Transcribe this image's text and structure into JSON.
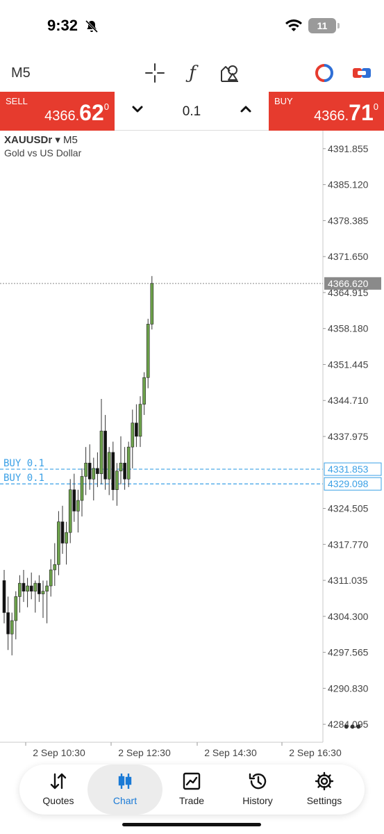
{
  "status_bar": {
    "time": "9:32",
    "battery": "11"
  },
  "toolbar": {
    "timeframe": "M5",
    "icons": [
      "crosshair-icon",
      "function-icon",
      "objects-icon",
      "one-click-trading-icon",
      "chart-toggle-icon"
    ],
    "func_glyph": "ƒ"
  },
  "trade": {
    "sell_label": "SELL",
    "sell_price_small": "4366.",
    "sell_price_big": "62",
    "sell_price_sup": "0",
    "buy_label": "BUY",
    "buy_price_small": "4366.",
    "buy_price_big": "71",
    "buy_price_sup": "0",
    "volume": "0.1"
  },
  "chart": {
    "symbol": "XAUUSDr",
    "timeframe_suffix": "▾ M5",
    "description": "Gold vs US Dollar",
    "more": "•••"
  },
  "chart_data": {
    "type": "candlestick",
    "symbol": "XAUUSDr",
    "timeframe": "M5",
    "ylim": [
      4280.73,
      4395.22
    ],
    "y_ticks": [
      "4391.855",
      "4385.120",
      "4378.385",
      "4371.650",
      "4364.915",
      "4358.180",
      "4351.445",
      "4344.710",
      "4337.975",
      "4324.505",
      "4317.770",
      "4311.035",
      "4304.300",
      "4297.565",
      "4290.830",
      "4284.095"
    ],
    "x_ticks": [
      "2 Sep 10:30",
      "2 Sep 12:30",
      "2 Sep 14:30",
      "2 Sep 16:30"
    ],
    "current_price": {
      "value": 4366.62,
      "label": "4366.620"
    },
    "orders": [
      {
        "label": "BUY 0.1",
        "price": 4331.853,
        "price_label": "4331.853"
      },
      {
        "label": "BUY 0.1",
        "price": 4329.098,
        "price_label": "4329.098"
      }
    ],
    "candles": [
      {
        "o": 4311.0,
        "h": 4313.0,
        "l": 4303.0,
        "c": 4305.0
      },
      {
        "o": 4305.0,
        "h": 4308.0,
        "l": 4298.0,
        "c": 4301.0
      },
      {
        "o": 4301.0,
        "h": 4305.0,
        "l": 4297.0,
        "c": 4303.5
      },
      {
        "o": 4303.5,
        "h": 4309.0,
        "l": 4300.0,
        "c": 4308.0
      },
      {
        "o": 4308.0,
        "h": 4312.0,
        "l": 4305.0,
        "c": 4310.5
      },
      {
        "o": 4310.5,
        "h": 4313.0,
        "l": 4307.0,
        "c": 4309.0
      },
      {
        "o": 4309.0,
        "h": 4311.5,
        "l": 4306.0,
        "c": 4310.0
      },
      {
        "o": 4310.0,
        "h": 4312.5,
        "l": 4307.5,
        "c": 4309.0
      },
      {
        "o": 4309.0,
        "h": 4311.0,
        "l": 4305.0,
        "c": 4310.5
      },
      {
        "o": 4310.5,
        "h": 4312.0,
        "l": 4307.0,
        "c": 4308.5
      },
      {
        "o": 4308.5,
        "h": 4311.0,
        "l": 4304.0,
        "c": 4309.0
      },
      {
        "o": 4309.0,
        "h": 4311.0,
        "l": 4303.0,
        "c": 4310.0
      },
      {
        "o": 4310.0,
        "h": 4315.0,
        "l": 4308.0,
        "c": 4313.0
      },
      {
        "o": 4313.0,
        "h": 4318.0,
        "l": 4310.0,
        "c": 4314.0
      },
      {
        "o": 4314.0,
        "h": 4324.0,
        "l": 4312.0,
        "c": 4322.0
      },
      {
        "o": 4322.0,
        "h": 4325.0,
        "l": 4316.0,
        "c": 4318.0
      },
      {
        "o": 4318.0,
        "h": 4322.0,
        "l": 4314.0,
        "c": 4320.0
      },
      {
        "o": 4320.0,
        "h": 4330.0,
        "l": 4318.0,
        "c": 4328.0
      },
      {
        "o": 4328.0,
        "h": 4331.0,
        "l": 4322.0,
        "c": 4324.0
      },
      {
        "o": 4324.0,
        "h": 4328.0,
        "l": 4320.0,
        "c": 4326.0
      },
      {
        "o": 4326.0,
        "h": 4332.0,
        "l": 4323.0,
        "c": 4330.5
      },
      {
        "o": 4330.5,
        "h": 4336.0,
        "l": 4327.0,
        "c": 4333.0
      },
      {
        "o": 4333.0,
        "h": 4336.5,
        "l": 4328.0,
        "c": 4330.0
      },
      {
        "o": 4330.0,
        "h": 4334.0,
        "l": 4326.0,
        "c": 4332.0
      },
      {
        "o": 4332.0,
        "h": 4335.0,
        "l": 4328.5,
        "c": 4331.0
      },
      {
        "o": 4331.0,
        "h": 4345.0,
        "l": 4329.0,
        "c": 4339.0
      },
      {
        "o": 4339.0,
        "h": 4342.0,
        "l": 4328.0,
        "c": 4330.0
      },
      {
        "o": 4330.0,
        "h": 4336.0,
        "l": 4327.0,
        "c": 4335.0
      },
      {
        "o": 4335.0,
        "h": 4337.0,
        "l": 4326.0,
        "c": 4328.0
      },
      {
        "o": 4328.0,
        "h": 4333.0,
        "l": 4325.0,
        "c": 4331.5
      },
      {
        "o": 4331.5,
        "h": 4338.0,
        "l": 4329.0,
        "c": 4333.0
      },
      {
        "o": 4333.0,
        "h": 4336.0,
        "l": 4328.0,
        "c": 4330.0
      },
      {
        "o": 4330.0,
        "h": 4337.0,
        "l": 4328.5,
        "c": 4336.0
      },
      {
        "o": 4336.0,
        "h": 4343.0,
        "l": 4332.0,
        "c": 4340.5
      },
      {
        "o": 4340.5,
        "h": 4344.0,
        "l": 4336.0,
        "c": 4338.0
      },
      {
        "o": 4338.0,
        "h": 4345.5,
        "l": 4336.0,
        "c": 4344.0
      },
      {
        "o": 4344.0,
        "h": 4350.0,
        "l": 4342.0,
        "c": 4349.0
      },
      {
        "o": 4349.0,
        "h": 4360.0,
        "l": 4347.0,
        "c": 4359.0
      },
      {
        "o": 4359.0,
        "h": 4368.0,
        "l": 4358.0,
        "c": 4366.62
      }
    ]
  },
  "nav": {
    "items": [
      {
        "label": "Quotes"
      },
      {
        "label": "Chart"
      },
      {
        "label": "Trade"
      },
      {
        "label": "History"
      },
      {
        "label": "Settings"
      }
    ]
  },
  "colors": {
    "accent_red": "#e63b2e",
    "bull": "#6da24b",
    "bear": "#111111",
    "order_line": "#3aa0e6",
    "nav_active": "#1a7ad6"
  }
}
